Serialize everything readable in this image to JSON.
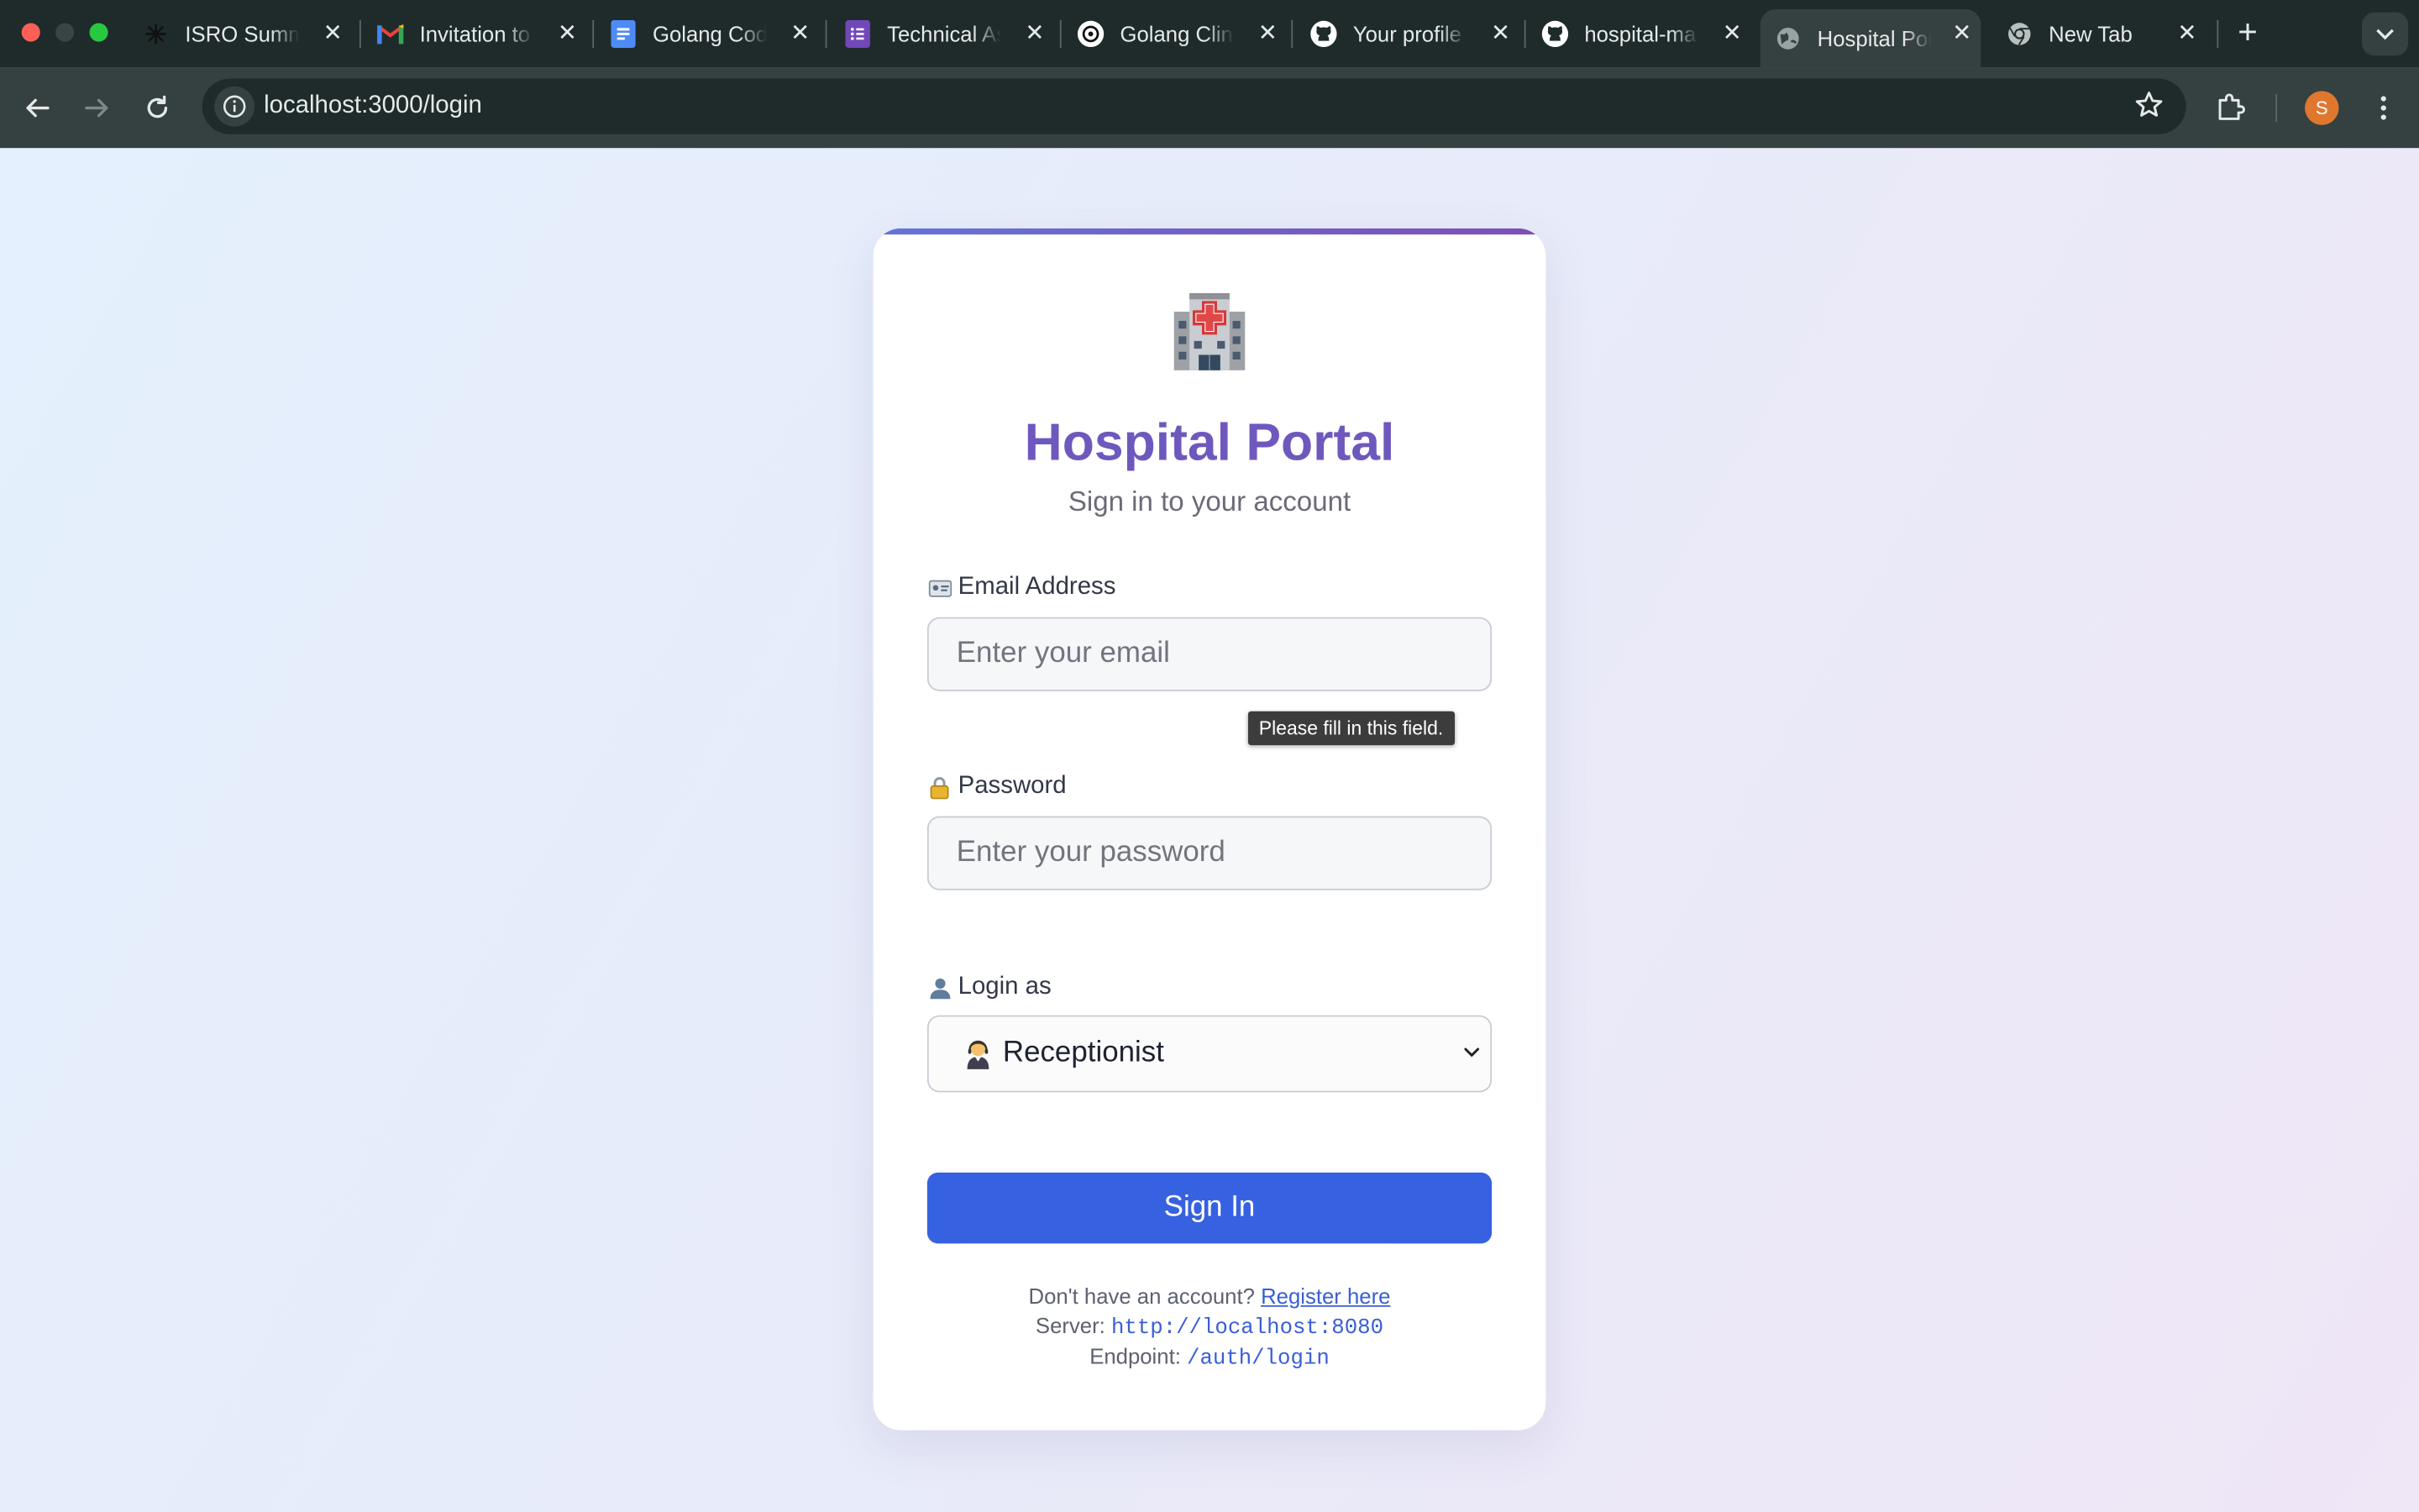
{
  "browser": {
    "tabs": [
      {
        "title": "ISRO Summ",
        "icon": "asterisk-icon"
      },
      {
        "title": "Invitation to",
        "icon": "gmail-icon"
      },
      {
        "title": "Golang Cod",
        "icon": "google-docs-icon"
      },
      {
        "title": "Technical As",
        "icon": "google-forms-icon"
      },
      {
        "title": "Golang Clin",
        "icon": "chatgpt-icon"
      },
      {
        "title": "Your profile",
        "icon": "github-icon"
      },
      {
        "title": "hospital-ma",
        "icon": "github-icon"
      },
      {
        "title": "Hospital Por",
        "icon": "globe-icon",
        "active": true
      },
      {
        "title": "New Tab",
        "icon": "chrome-icon"
      }
    ],
    "url": "localhost:3000/login",
    "profile_initial": "S"
  },
  "login": {
    "title": "Hospital Portal",
    "subtitle": "Sign in to your account",
    "email_label": "Email Address",
    "email_placeholder": "Enter your email",
    "email_value": "",
    "validation_tooltip": "Please fill in this field.",
    "password_label": "Password",
    "password_placeholder": "Enter your password",
    "password_value": "",
    "role_label": "Login as",
    "role_selected": "Receptionist",
    "submit_label": "Sign In",
    "register_prompt": "Don't have an account?",
    "register_link": "Register here",
    "server_label": "Server:",
    "server_value": "http://localhost:8080",
    "endpoint_label": "Endpoint:",
    "endpoint_value": "/auth/login"
  },
  "colors": {
    "accent": "#6f58bd",
    "button": "#3661e0",
    "link": "#3a5fd6",
    "chrome_dark": "#1f2b2b",
    "chrome_toolbar": "#354141"
  }
}
